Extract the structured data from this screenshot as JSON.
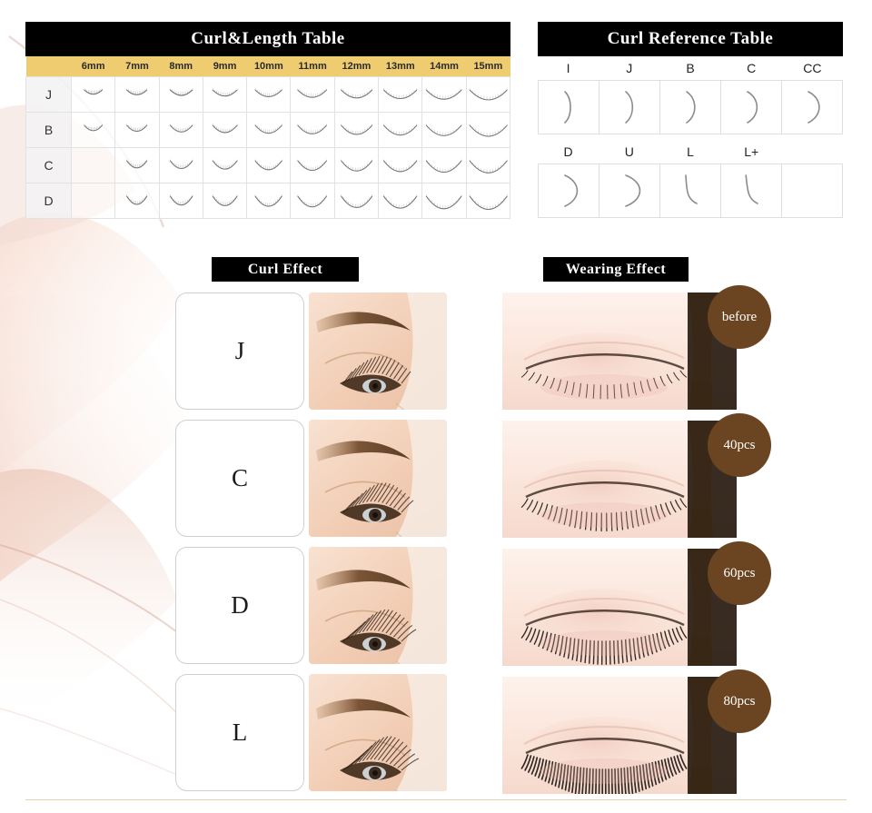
{
  "curl_length_table": {
    "title": "Curl&Length Table",
    "header_bg": "#EFCC6F",
    "title_bg": "#000000",
    "lengths": [
      "6mm",
      "7mm",
      "8mm",
      "9mm",
      "10mm",
      "11mm",
      "12mm",
      "13mm",
      "14mm",
      "15mm"
    ],
    "rows": [
      {
        "label": "J",
        "cells": [
          1,
          1,
          1,
          1,
          1,
          1,
          1,
          1,
          1,
          1
        ]
      },
      {
        "label": "B",
        "cells": [
          1,
          1,
          1,
          1,
          1,
          1,
          1,
          1,
          1,
          1
        ]
      },
      {
        "label": "C",
        "cells": [
          0,
          1,
          1,
          1,
          1,
          1,
          1,
          1,
          1,
          1
        ]
      },
      {
        "label": "D",
        "cells": [
          0,
          1,
          1,
          1,
          1,
          1,
          1,
          1,
          1,
          1
        ]
      }
    ]
  },
  "curl_reference_table": {
    "title": "Curl Reference Table",
    "row1": [
      "I",
      "J",
      "B",
      "C",
      "CC"
    ],
    "row2": [
      "D",
      "U",
      "L",
      "L+",
      ""
    ]
  },
  "curl_effect": {
    "title": "Curl Effect",
    "items": [
      {
        "letter": "J"
      },
      {
        "letter": "C"
      },
      {
        "letter": "D"
      },
      {
        "letter": "L"
      }
    ]
  },
  "wearing_effect": {
    "title": "Wearing Effect",
    "badge_color": "#6B4522",
    "items": [
      {
        "badge": "before"
      },
      {
        "badge": "40pcs"
      },
      {
        "badge": "60pcs"
      },
      {
        "badge": "80pcs"
      }
    ]
  }
}
